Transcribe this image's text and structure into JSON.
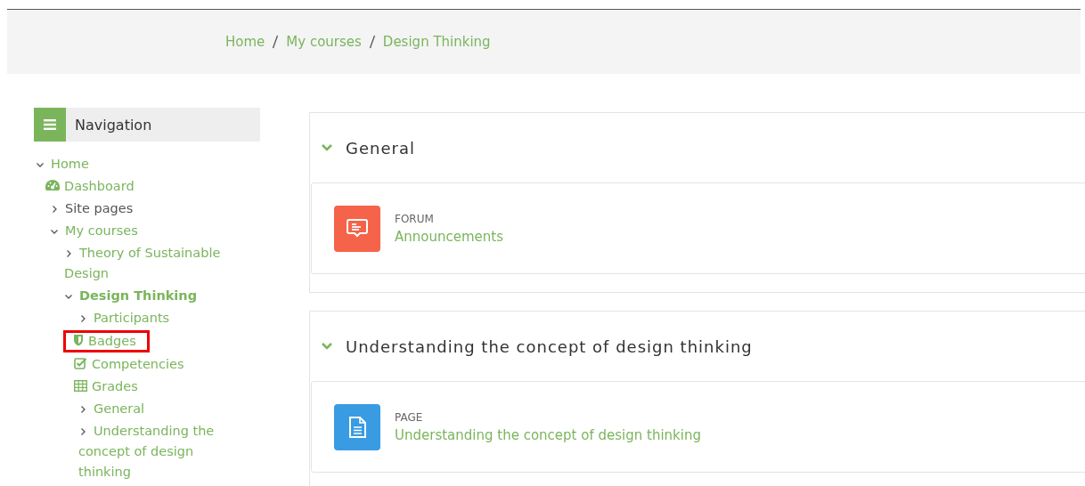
{
  "breadcrumb": [
    "Home",
    "My courses",
    "Design Thinking"
  ],
  "navigation": {
    "title": "Navigation",
    "items": [
      {
        "label": "Home",
        "kind": "branch",
        "expanded": true,
        "linked": true,
        "current": false,
        "highlighted": false,
        "children": [
          {
            "label": "Dashboard",
            "kind": "gauge",
            "linked": true,
            "current": false,
            "highlighted": false
          },
          {
            "label": "Site pages",
            "kind": "branch",
            "expanded": false,
            "linked": false,
            "current": false,
            "highlighted": false
          },
          {
            "label": "My courses",
            "kind": "branch",
            "expanded": true,
            "linked": true,
            "current": false,
            "highlighted": false,
            "children": [
              {
                "label": "Theory of Sustainable Design",
                "kind": "branch",
                "expanded": false,
                "linked": true,
                "current": false,
                "highlighted": false
              },
              {
                "label": "Design Thinking",
                "kind": "branch",
                "expanded": true,
                "linked": true,
                "current": true,
                "highlighted": false,
                "children": [
                  {
                    "label": "Participants",
                    "kind": "branch",
                    "expanded": false,
                    "linked": true,
                    "current": false,
                    "highlighted": false
                  },
                  {
                    "label": "Badges",
                    "kind": "shield",
                    "linked": true,
                    "current": false,
                    "highlighted": true
                  },
                  {
                    "label": "Competencies",
                    "kind": "check",
                    "linked": true,
                    "current": false,
                    "highlighted": false
                  },
                  {
                    "label": "Grades",
                    "kind": "table",
                    "linked": true,
                    "current": false,
                    "highlighted": false
                  },
                  {
                    "label": "General",
                    "kind": "branch",
                    "expanded": false,
                    "linked": true,
                    "current": false,
                    "highlighted": false
                  },
                  {
                    "label": "Understanding the concept of design thinking",
                    "kind": "branch",
                    "expanded": false,
                    "linked": true,
                    "current": false,
                    "highlighted": false
                  }
                ]
              }
            ]
          }
        ]
      }
    ]
  },
  "sections": [
    {
      "title": "General",
      "expanded": true,
      "activities": [
        {
          "kind": "forum",
          "type": "FORUM",
          "name": "Announcements"
        }
      ]
    },
    {
      "title": "Understanding the concept of design thinking",
      "expanded": true,
      "activities": [
        {
          "kind": "page",
          "type": "PAGE",
          "name": "Understanding the concept of design thinking"
        }
      ]
    }
  ]
}
